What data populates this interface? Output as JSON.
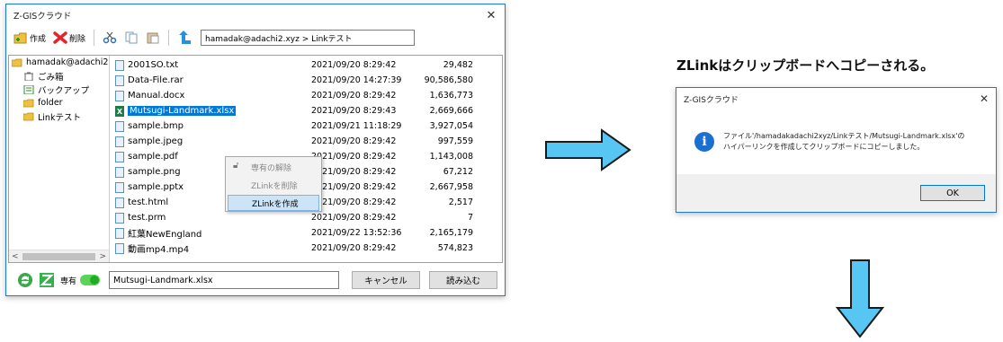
{
  "main_window": {
    "title": "Z-GISクラウド",
    "close_glyph": "✕",
    "toolbar": {
      "create_label": "作成",
      "delete_label": "削除",
      "path_value": "hamadak@adachi2.xyz > Linkテスト"
    },
    "tree": {
      "root_label": "hamadak@adachi2",
      "items": [
        {
          "label": "ごみ箱",
          "icon": "trash-icon"
        },
        {
          "label": "バックアップ",
          "icon": "backup-icon"
        },
        {
          "label": "folder",
          "icon": "folder-icon"
        },
        {
          "label": "Linkテスト",
          "icon": "folder-icon"
        }
      ],
      "scroll_left": "<",
      "scroll_right": ">"
    },
    "files": [
      {
        "name": "2001SO.txt",
        "date": "2021/09/20 8:29:42",
        "size": "29,482"
      },
      {
        "name": "Data-File.rar",
        "date": "2021/09/20 14:27:39",
        "size": "90,586,580"
      },
      {
        "name": "Manual.docx",
        "date": "2021/09/20 8:29:42",
        "size": "1,636,773"
      },
      {
        "name": "Mutsugi-Landmark.xlsx",
        "date": "2021/09/20 8:29:43",
        "size": "2,669,666"
      },
      {
        "name": "sample.bmp",
        "date": "2021/09/21 11:18:29",
        "size": "3,927,054"
      },
      {
        "name": "sample.jpeg",
        "date": "2021/09/20 8:29:42",
        "size": "997,559"
      },
      {
        "name": "sample.pdf",
        "date": "2021/09/20 8:29:42",
        "size": "1,143,008"
      },
      {
        "name": "sample.png",
        "date": "2021/09/20 8:29:42",
        "size": "67,212"
      },
      {
        "name": "sample.pptx",
        "date": "2021/09/20 8:29:42",
        "size": "2,667,958"
      },
      {
        "name": "test.html",
        "date": "2021/09/20 8:29:42",
        "size": "2,517"
      },
      {
        "name": "test.prm",
        "date": "2021/09/20 8:29:42",
        "size": "7"
      },
      {
        "name": "紅葉NewEngland",
        "date": "2021/09/22 13:52:36",
        "size": "2,165,179"
      },
      {
        "name": "動画mp4.mp4",
        "date": "2021/09/20 8:29:42",
        "size": "574,823"
      }
    ],
    "context_menu": {
      "items": [
        "専有の解除",
        "ZLinkを削除",
        "ZLinkを作成"
      ]
    },
    "statusbar": {
      "exclusive_label": "専有",
      "filename_value": "Mutsugi-Landmark.xlsx",
      "cancel_label": "キャンセル",
      "load_label": "読み込む"
    }
  },
  "caption": "ZLinkはクリップボードへコピーされる。",
  "dialog": {
    "title": "Z-GISクラウド",
    "close_glyph": "✕",
    "message_line1": "ファイル'/hamadakadachi2xyz/Linkテスト/Mutsugi-Landmark.xlsx'の",
    "message_line2": "ハイパーリンクを作成してクリップボードにコピーしました。",
    "ok_label": "OK"
  },
  "colors": {
    "accent": "#0078d7",
    "arrow_fill": "#58c6f2",
    "arrow_stroke": "#1a1a1a",
    "toggle": "#5bd35b",
    "info": "#1b6fd1"
  }
}
